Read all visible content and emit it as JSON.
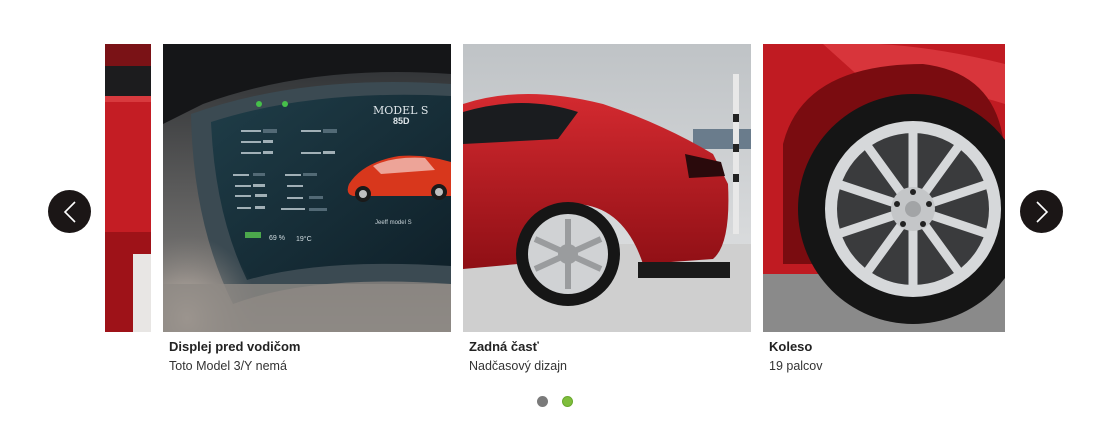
{
  "carousel": {
    "slides": [
      {
        "title": "",
        "subtitle": "",
        "image": "red-car-body-partial"
      },
      {
        "title": "Displej pred vodičom",
        "subtitle": "Toto Model 3/Y nemá",
        "image": "dashboard-display",
        "dashboard_text": {
          "brand": "MODEL S",
          "variant": "85D",
          "name": "Jeeff model S",
          "battery": "69 %",
          "temperature": "19°C"
        }
      },
      {
        "title": "Zadná časť",
        "subtitle": "Nadčasový dizajn",
        "image": "red-car-rear"
      },
      {
        "title": "Koleso",
        "subtitle": "19 palcov",
        "image": "red-car-wheel"
      }
    ],
    "prev_icon": "chevron-left-icon",
    "next_icon": "chevron-right-icon",
    "pagination": {
      "count": 2,
      "active_index": 1
    }
  },
  "colors": {
    "arrow_bg": "#1b1616",
    "dot_inactive": "#7a7a7a",
    "dot_active": "#7fbe3c",
    "car_red": "#c01b22"
  }
}
